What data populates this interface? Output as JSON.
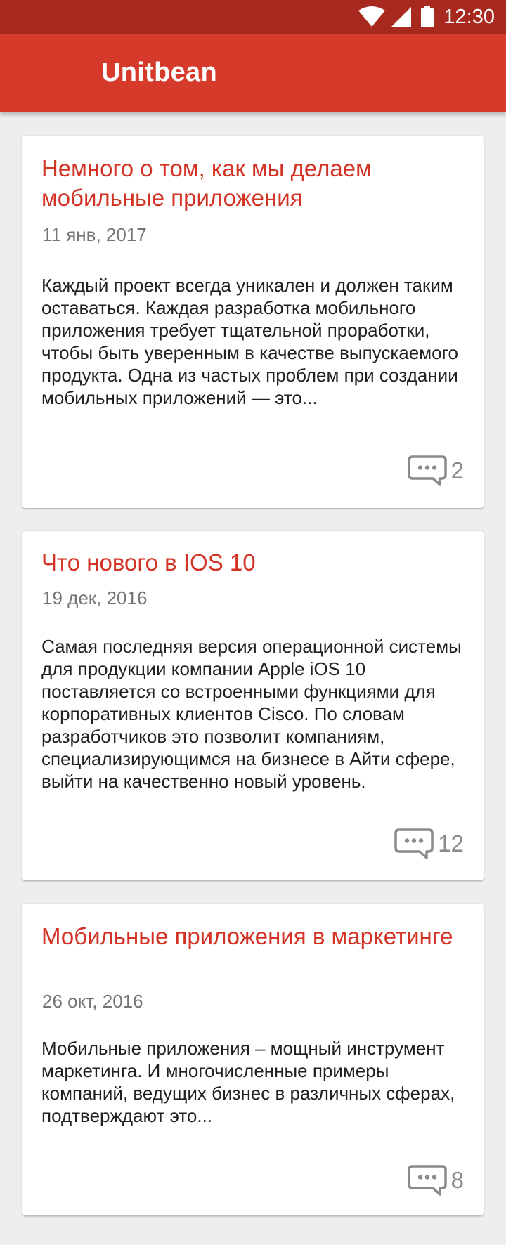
{
  "status_bar": {
    "time": "12:30",
    "icons": [
      "wifi-icon",
      "signal-icon",
      "battery-icon"
    ]
  },
  "app_bar": {
    "title": "Unitbean"
  },
  "colors": {
    "status_bar": "#a8291d",
    "app_bar": "#d63a2a",
    "title_red": "#d33324",
    "background": "#eeeeee"
  },
  "posts": [
    {
      "title": "Немного о том, как мы делаем мобильные приложения",
      "date": "11 янв, 2017",
      "excerpt": "Каждый проект всегда уникален и должен таким оставаться. Каждая разработка мобильного приложения требует тщательной проработки, чтобы быть уверенным в качестве выпускаемого продукта. Одна из частых проблем при создании мобильных приложений — это...",
      "comments_icon": "comment-icon",
      "comments": "2"
    },
    {
      "title": "Что нового в IOS 10",
      "date": "19 дек, 2016",
      "excerpt": "Самая последняя версия операционной системы для продукции компании Apple iOS 10 поставляется со встроенными функциями для корпоративных клиентов Cisco. По словам разработчиков это позволит компаниям, специализирующимся на бизнесе в Айти сфере, выйти на качественно новый уровень.",
      "comments_icon": "comment-icon",
      "comments": "12"
    },
    {
      "title": "Мобильные приложения в маркетинге",
      "date": "26 окт, 2016",
      "excerpt": "Мобильные приложения – мощный инструмент маркетинга. И многочисленные примеры компаний, ведущих бизнес в различных сферах, подтверждают это...",
      "comments_icon": "comment-icon",
      "comments": "8"
    }
  ]
}
